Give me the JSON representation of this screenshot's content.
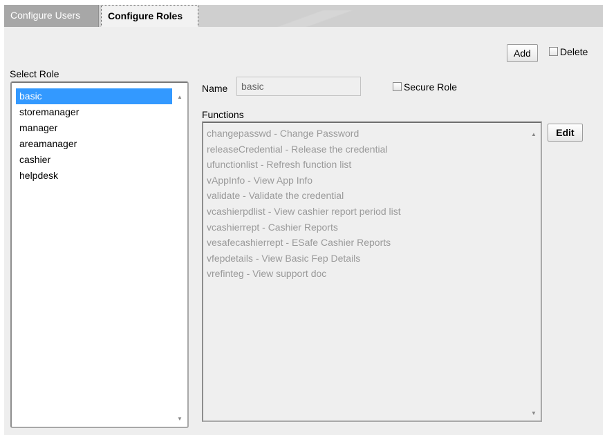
{
  "tabs": [
    {
      "label": "Configure Users"
    },
    {
      "label": "Configure Roles"
    }
  ],
  "toolbar": {
    "add_label": "Add",
    "delete_label": "Delete"
  },
  "roles": {
    "heading": "Select Role",
    "items": [
      "basic",
      "storemanager",
      "manager",
      "areamanager",
      "cashier",
      "helpdesk"
    ],
    "selected": "basic"
  },
  "details": {
    "name_label": "Name",
    "name_value": "basic",
    "secure_label": "Secure Role",
    "functions_label": "Functions",
    "edit_label": "Edit",
    "functions": [
      "changepasswd - Change Password",
      "releaseCredential - Release the credential",
      "ufunctionlist - Refresh function list",
      "vAppInfo - View App Info",
      "validate - Validate the credential",
      "vcashierpdlist - View cashier report period list",
      "vcashierrept - Cashier Reports",
      "vesafecashierrept - ESafe Cashier Reports",
      "vfepdetails - View Basic Fep Details",
      "vrefinteg - View support doc"
    ]
  },
  "colors": {
    "selection": "#3399ff",
    "tab_inactive": "#a7a7a7",
    "panel": "#eeeeee"
  }
}
